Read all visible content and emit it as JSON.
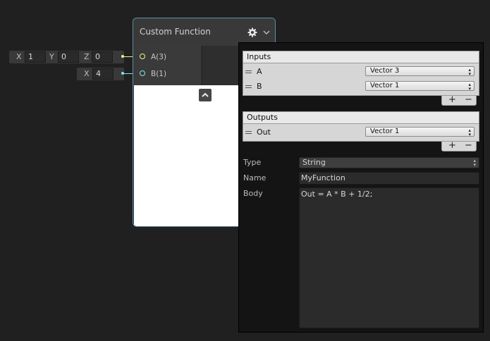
{
  "ports": {
    "a": {
      "x_label": "X",
      "x_value": "1",
      "y_label": "Y",
      "y_value": "0",
      "z_label": "Z",
      "z_value": "0",
      "slot_name": "A(3)",
      "color": "#f2f08a"
    },
    "b": {
      "x_label": "X",
      "x_value": "4",
      "slot_name": "B(1)",
      "color": "#84e4e7"
    }
  },
  "node": {
    "title": "Custom Function",
    "settings_icon": "gear-icon",
    "collapse_icon": "chevron-down-icon",
    "preview_toggle_icon": "chevron-up-icon"
  },
  "inspector": {
    "inputs": {
      "header": "Inputs",
      "rows": [
        {
          "name": "A",
          "type": "Vector 3"
        },
        {
          "name": "B",
          "type": "Vector 1"
        }
      ],
      "add": "+",
      "remove": "−"
    },
    "outputs": {
      "header": "Outputs",
      "rows": [
        {
          "name": "Out",
          "type": "Vector 1"
        }
      ],
      "add": "+",
      "remove": "−"
    },
    "type_label": "Type",
    "type_value": "String",
    "name_label": "Name",
    "name_value": "MyFunction",
    "body_label": "Body",
    "body_value": "Out = A * B + 1/2;"
  }
}
